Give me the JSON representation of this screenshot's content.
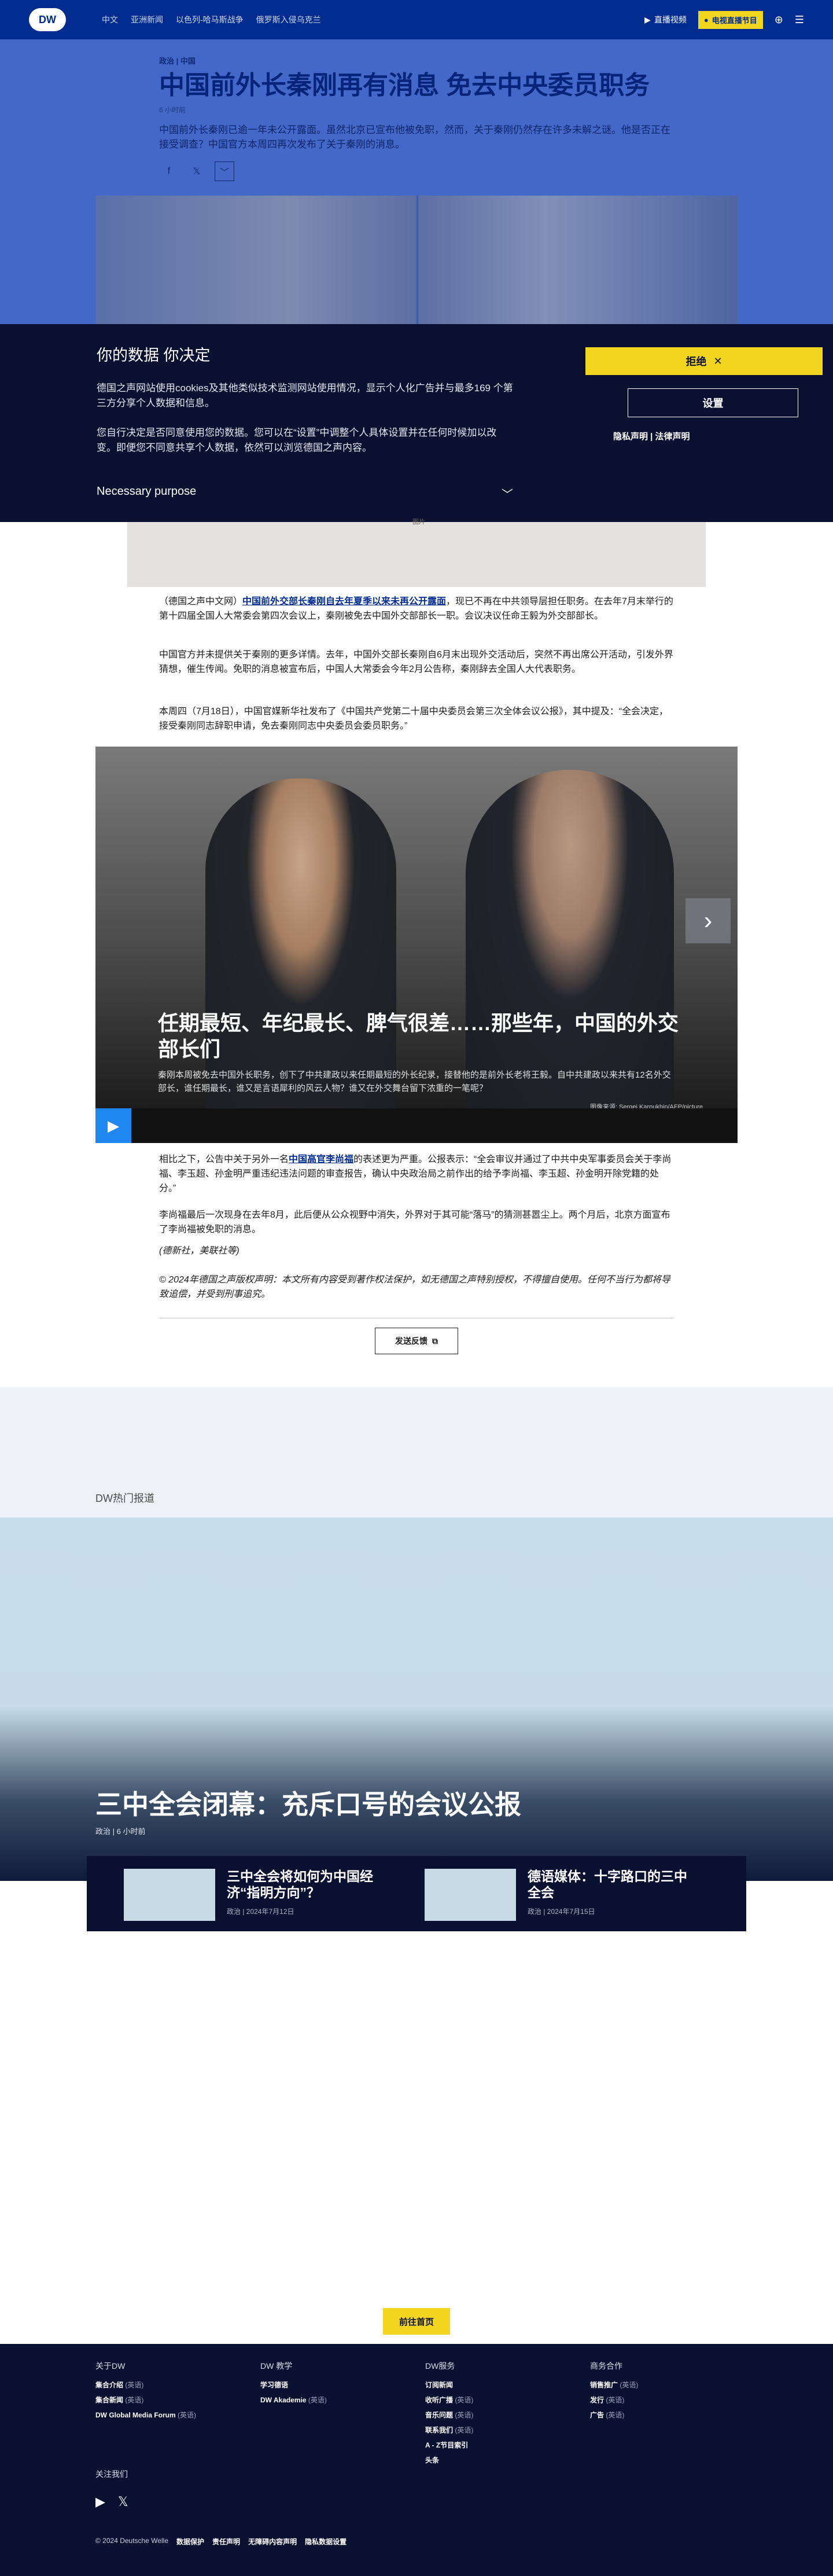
{
  "nav": {
    "logo": "DW",
    "links": [
      "中文",
      "亚洲新闻",
      "以色列-哈马斯战争",
      "俄罗斯入侵乌克兰"
    ],
    "live": "直播视频",
    "program": "电视直播节目"
  },
  "article": {
    "kicker": "政治 | 中国",
    "headline": "中国前外长秦刚再有消息 免去中央委员职务",
    "time": "6 小时前",
    "lead": "中国前外长秦刚已逾一年未公开露面。虽然北京已宣布他被免职，然而，关于秦刚仍然存在许多未解之谜。他是否正在接受调查？中国官方本周四再次发布了关于秦刚的消息。",
    "share": [
      "f",
      "𝕏",
      "﹀"
    ],
    "image_credit": "图片"
  },
  "cookie": {
    "title": "你的数据 你决定",
    "text1": "德国之声网站使用cookies及其他类似技术监测网站使用情况，显示个人化广告并与最多169 个第三方分享个人数据和信息。",
    "text2": "您自行决定是否同意使用您的数据。您可以在“设置”中调整个人具体设置并在任何时候加以改变。即便您不同意共享个人数据，依然可以浏览德国之声内容。",
    "purpose": "Necessary purpose",
    "reject": "拒绝",
    "settings": "设置",
    "links": "隐私声明 | 法律声明"
  },
  "body": {
    "p1_prefix": "（德国之声中文网）",
    "p1_link": "中国前外交部长秦刚自去年夏季以来未再公开露面",
    "p1_rest": "，现已不再在中共领导层担任职务。在去年7月末举行的第十四届全国人大常委会第四次会议上，秦刚被免去中国外交部部长一职。会议决议任命王毅为外交部部长。",
    "p2": "中国官方并未提供关于秦刚的更多详情。去年，中国外交部长秦刚自6月末出现外交活动后，突然不再出席公开活动，引发外界猜想，催生传闻。免职的消息被宣布后，中国人大常委会今年2月公告称，秦刚辞去全国人大代表职务。",
    "p3": "本周四（7月18日），中国官媒新华社发布了《中国共产党第二十届中央委员会第三次全体会议公报》，其中提及：“全会决定，接受秦刚同志辞职申请，免去秦刚同志中央委员会委员职务。”",
    "p4_prefix": "相比之下，公告中关于另外一名",
    "p4_link": "中国高官李尚福",
    "p4_rest": "的表述更为严重。公报表示：“全会审议并通过了中共中央军事委员会关于李尚福、李玉超、孙金明严重违纪违法问题的审查报告，确认中央政治局之前作出的给予李尚福、李玉超、孙金明开除党籍的处分。”",
    "p5": "李尚福最后一次现身在去年8月，此后便从公众视野中消失，外界对于其可能“落马”的猜测甚嚣尘上。两个月后，北京方面宣布了李尚福被免职的消息。",
    "p6": "(德新社，美联社等)",
    "p7": "© 2024年德国之声版权声明：本文所有内容受到著作权法保护，如无德国之声特别授权，不得擅自使用。任何不当行为都将导致追偿，并受到刑事追究。",
    "feedback": "发送反馈"
  },
  "gallery": {
    "title": "任期最短、年纪最长、脾气很差……那些年，中国的外交部长们",
    "desc": "秦刚本周被免去中国外长职务，创下了中共建政以来任期最短的外长纪录，接替他的是前外长老将王毅。自中共建政以来共有12名外交部长，谁任期最长，谁又是言语犀利的风云人物？谁又在外交舞台留下浓重的一笔呢？",
    "credit": "图像来源: Sergei Karpukhin/AFP/picture alliance/dpa/TASS"
  },
  "trending": {
    "label": "DW热门报道",
    "title": "三中全会闭幕：充斥口号的会议公报",
    "meta": "政治 | 6 小时前",
    "cards": [
      {
        "title": "三中全会将如何为中国经济“指明方向”？",
        "meta": "政治 | 2024年7月12日"
      },
      {
        "title": "德语媒体：十字路口的三中全会",
        "meta": "政治 | 2024年7月15日"
      }
    ]
  },
  "home_button": "前往首页",
  "footer": {
    "cols": [
      {
        "head": "关于DW",
        "items": [
          [
            "集合介绍",
            "(英语)"
          ],
          [
            "集合新闻",
            "(英语)"
          ],
          [
            "DW Global Media Forum",
            "(英语)"
          ]
        ]
      },
      {
        "head": "DW 教学",
        "items": [
          [
            "学习德语",
            ""
          ],
          [
            "DW Akademie",
            "(英语)"
          ]
        ]
      },
      {
        "head": "DW服务",
        "items": [
          [
            "订阅新闻",
            ""
          ],
          [
            "收听广播",
            "(英语)"
          ],
          [
            "音乐问题",
            "(英语)"
          ],
          [
            "联系我们",
            "(英语)"
          ],
          [
            "A - Z节目索引",
            ""
          ],
          [
            "头条",
            ""
          ]
        ]
      },
      {
        "head": "商务合作",
        "items": [
          [
            "销售推广",
            "(英语)"
          ],
          [
            "发行",
            "(英语)"
          ],
          [
            "广告",
            "(英语)"
          ]
        ]
      }
    ],
    "follow": "关注我们",
    "social": [
      "▶",
      "𝕏"
    ],
    "copyright": "© 2024 Deutsche Welle",
    "bottom_links": [
      "数据保护",
      "责任声明",
      "无障碍内容声明",
      "隐私数据设置"
    ]
  }
}
